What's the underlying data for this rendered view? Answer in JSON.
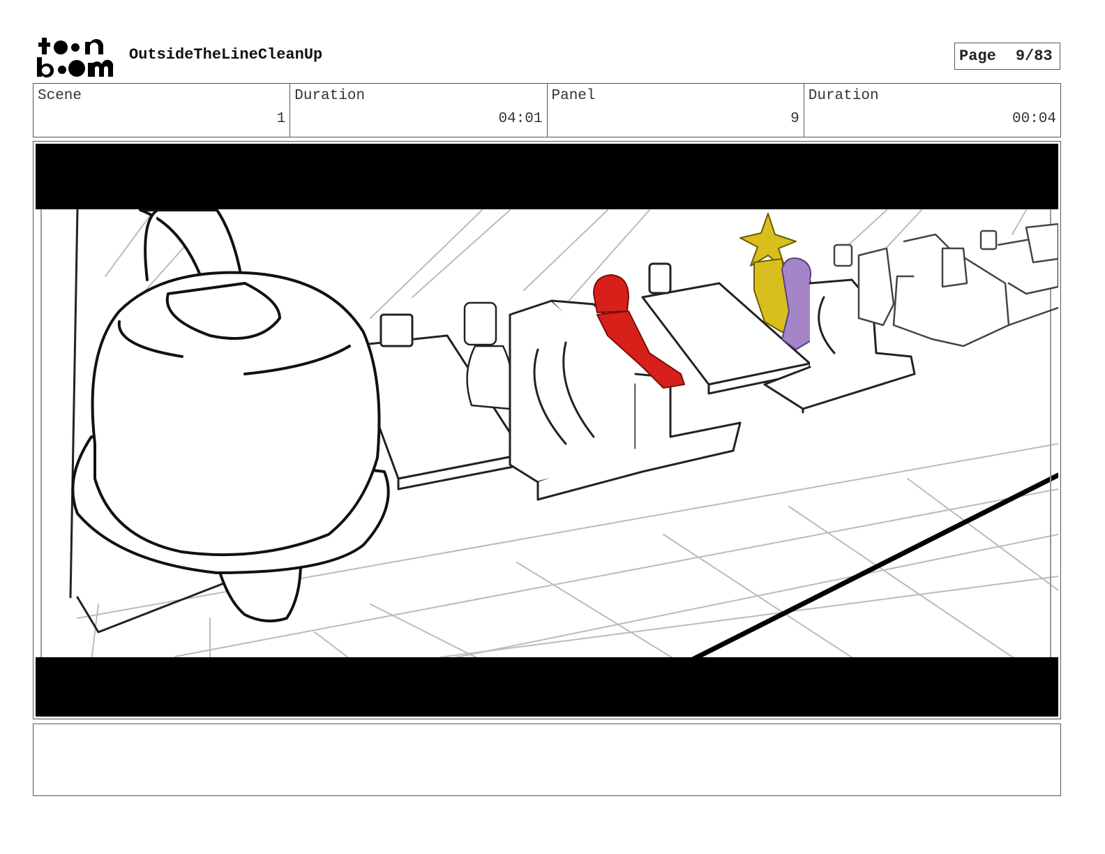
{
  "header": {
    "logo_text_top": "toon",
    "logo_text_bottom": "boom",
    "project_title": "OutsideTheLineCleanUp",
    "page_label": "Page",
    "page_value": "9/83"
  },
  "info": [
    {
      "label": "Scene",
      "value": "1"
    },
    {
      "label": "Duration",
      "value": "04:01"
    },
    {
      "label": "Panel",
      "value": "9"
    },
    {
      "label": "Duration",
      "value": "00:04"
    }
  ],
  "colors": {
    "character_red": "#d8201a",
    "character_yellow": "#d8bf1e",
    "character_purple": "#a486c8",
    "letterbox": "#000000"
  },
  "notes": ""
}
